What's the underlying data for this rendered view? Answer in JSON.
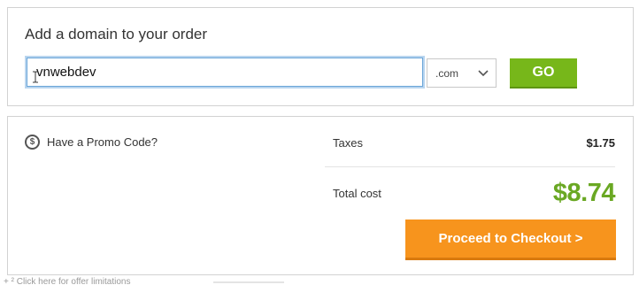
{
  "domain_panel": {
    "title": "Add a domain to your order",
    "input_value": "vnwebdev",
    "tld_selected": ".com",
    "go_label": "GO"
  },
  "summary_panel": {
    "promo_label": "Have a Promo Code?",
    "taxes_label": "Taxes",
    "taxes_value": "$1.75",
    "total_label": "Total cost",
    "total_value": "$8.74",
    "checkout_label": "Proceed to Checkout >"
  },
  "footer": {
    "fragment_text": "+ ² Click here for offer limitations"
  },
  "icons": {
    "promo": "dollar-circle-icon",
    "select": "chevron-down-icon",
    "cursor": "text-cursor-icon"
  },
  "colors": {
    "go_button": "#77b71a",
    "checkout_button": "#f7941d",
    "total_value": "#6aa823",
    "input_focus": "#6aa5d8"
  }
}
